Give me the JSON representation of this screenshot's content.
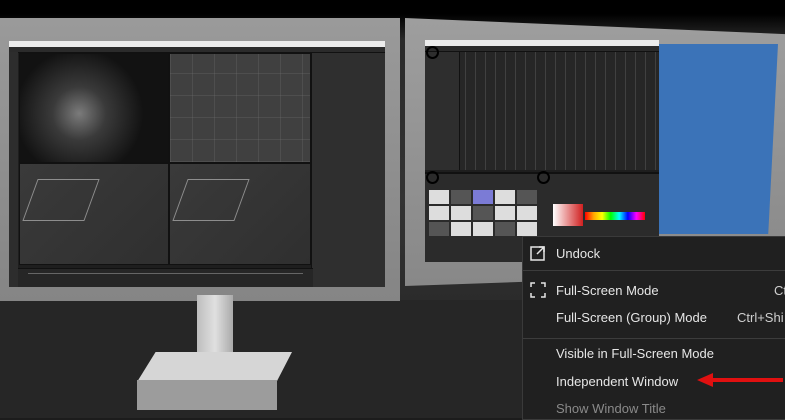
{
  "context_menu": {
    "items": [
      {
        "label": "Undock",
        "icon": "undock-icon",
        "shortcut": ""
      },
      {
        "label": "Full-Screen Mode",
        "icon": "fullscreen-icon",
        "shortcut": "Ct"
      },
      {
        "label": "Full-Screen (Group) Mode",
        "icon": "",
        "shortcut": "Ctrl+Shi"
      },
      {
        "label": "Visible in Full-Screen Mode",
        "icon": "",
        "shortcut": ""
      },
      {
        "label": "Independent Window",
        "icon": "",
        "shortcut": ""
      },
      {
        "label": "Show Window Title",
        "icon": "",
        "shortcut": ""
      }
    ]
  },
  "annotations": {
    "marker_color": "#000000",
    "arrow_color": "#e01010"
  },
  "monitors": {
    "left_screen_app": "3D modeling application",
    "right_window_color": "#3b73b8"
  }
}
